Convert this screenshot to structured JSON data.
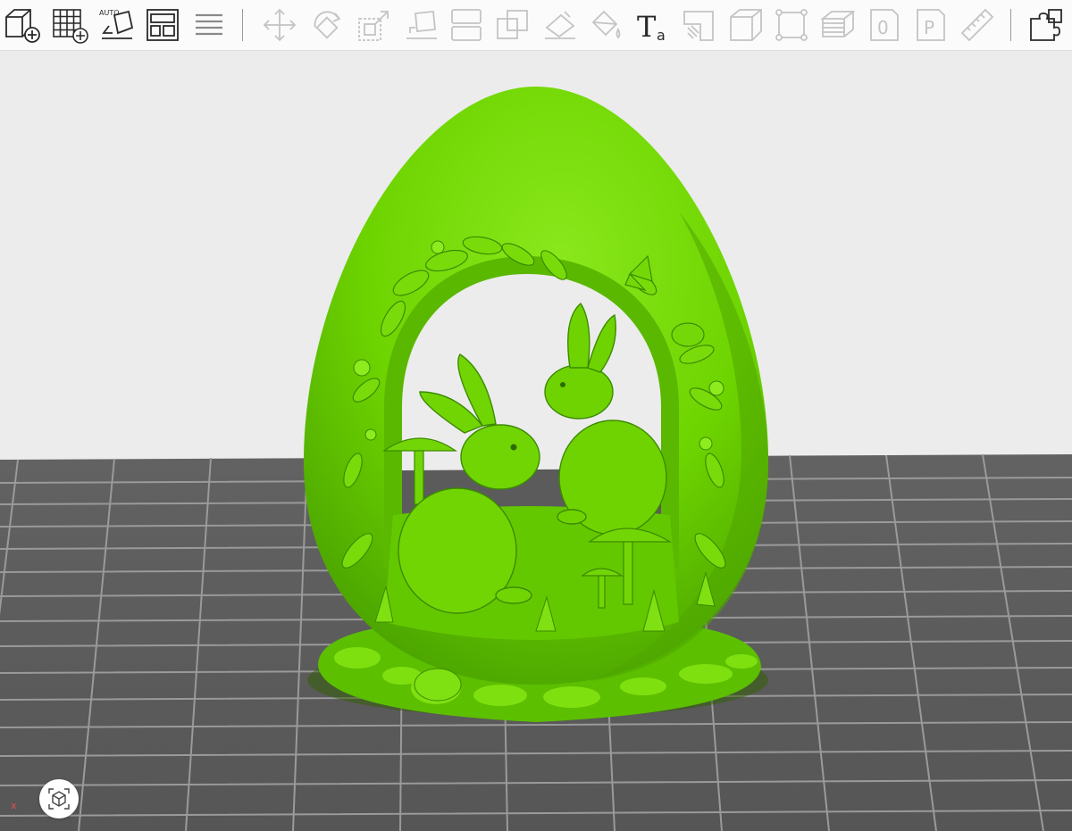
{
  "toolbar": {
    "auto_label": "AUTO",
    "text_icon_label": "T",
    "text_icon_sub": "a",
    "digit_zero": "0",
    "letter_p": "P",
    "tools": [
      {
        "name": "add-object",
        "icon": "cube-plus-icon",
        "enabled": true
      },
      {
        "name": "add-grid-array",
        "icon": "grid-plus-icon",
        "enabled": true
      },
      {
        "name": "auto-orient",
        "icon": "auto-orient-icon",
        "enabled": true
      },
      {
        "name": "arrange-layout",
        "icon": "layout-icon",
        "enabled": true
      },
      {
        "name": "layers",
        "icon": "lines-icon",
        "enabled": true
      },
      {
        "name": "move",
        "icon": "move-arrows-icon",
        "enabled": false
      },
      {
        "name": "rotate",
        "icon": "rotate-icon",
        "enabled": false
      },
      {
        "name": "scale",
        "icon": "scale-icon",
        "enabled": false
      },
      {
        "name": "lay-flat",
        "icon": "lay-flat-icon",
        "enabled": false
      },
      {
        "name": "cut",
        "icon": "split-icon",
        "enabled": false
      },
      {
        "name": "boolean",
        "icon": "overlap-squares-icon",
        "enabled": false
      },
      {
        "name": "support-paint",
        "icon": "support-paint-icon",
        "enabled": false
      },
      {
        "name": "color-paint",
        "icon": "paint-bucket-icon",
        "enabled": false
      },
      {
        "name": "text",
        "icon": "text-icon",
        "enabled": true
      },
      {
        "name": "seam-paint",
        "icon": "seam-icon",
        "enabled": false
      },
      {
        "name": "variable-layer-height",
        "icon": "cube-outline-icon",
        "enabled": false
      },
      {
        "name": "measure-bounds",
        "icon": "bounding-box-icon",
        "enabled": false
      },
      {
        "name": "slice-layers",
        "icon": "layer-stack-icon",
        "enabled": false
      },
      {
        "name": "plate-zero",
        "icon": "digit-zero-icon",
        "enabled": false
      },
      {
        "name": "plate-p",
        "icon": "letter-p-icon",
        "enabled": false
      },
      {
        "name": "measure-ruler",
        "icon": "ruler-icon",
        "enabled": false
      },
      {
        "name": "assembly",
        "icon": "puzzle-icon",
        "enabled": true
      }
    ]
  },
  "colors": {
    "model_green": "#6ed400",
    "model_green_light": "#8ae81c",
    "model_green_dark": "#3c8a00",
    "plate": "#5b5b5b",
    "plate_grid": "#9a9a9a",
    "background": "#ececec",
    "icon_enabled": "#2a2a2a",
    "icon_disabled": "#c4c4c4"
  },
  "viewport": {
    "axis_x_label": "x",
    "view_cube_icon": "view-cube-icon"
  }
}
